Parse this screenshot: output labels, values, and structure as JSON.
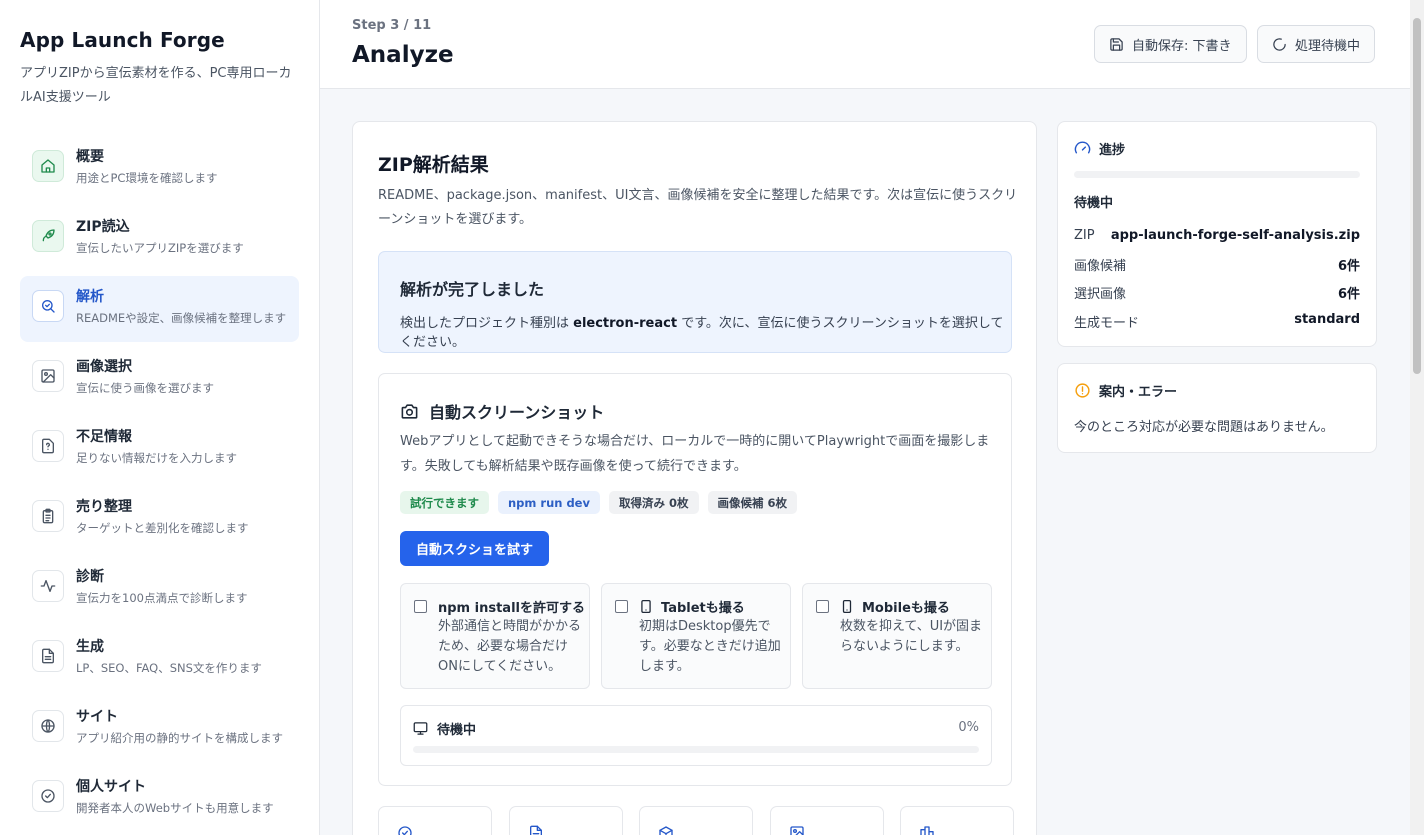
{
  "app": {
    "title": "App Launch Forge",
    "subtitle": "アプリZIPから宣伝素材を作る、PC専用ローカルAI支援ツール"
  },
  "nav": [
    {
      "label": "概要",
      "desc": "用途とPC環境を確認します",
      "icon": "home-icon"
    },
    {
      "label": "ZIP読込",
      "desc": "宣伝したいアプリZIPを選びます",
      "icon": "rocket-icon"
    },
    {
      "label": "解析",
      "desc": "READMEや設定、画像候補を整理します",
      "icon": "search-icon"
    },
    {
      "label": "画像選択",
      "desc": "宣伝に使う画像を選びます",
      "icon": "image-icon"
    },
    {
      "label": "不足情報",
      "desc": "足りない情報だけを入力します",
      "icon": "question-icon"
    },
    {
      "label": "売り整理",
      "desc": "ターゲットと差別化を確認します",
      "icon": "clipboard-icon"
    },
    {
      "label": "診断",
      "desc": "宣伝力を100点満点で診断します",
      "icon": "activity-icon"
    },
    {
      "label": "生成",
      "desc": "LP、SEO、FAQ、SNS文を作ります",
      "icon": "document-icon"
    },
    {
      "label": "サイト",
      "desc": "アプリ紹介用の静的サイトを構成します",
      "icon": "globe-icon"
    },
    {
      "label": "個人サイト",
      "desc": "開発者本人のWebサイトも用意します",
      "icon": "check-circle-icon"
    }
  ],
  "header": {
    "step": "Step 3 / 11",
    "title": "Analyze",
    "autosave_label": "自動保存: 下書き",
    "processing_label": "処理待機中"
  },
  "zip": {
    "title": "ZIP解析結果",
    "desc": "README、package.json、manifest、UI文言、画像候補を安全に整理した結果です。次は宣伝に使うスクリーンショットを選びます。",
    "done_title": "解析が完了しました",
    "done_prefix": "検出したプロジェクト種別は ",
    "done_type": "electron-react",
    "done_suffix": " です。次に、宣伝に使うスクリーンショットを選択してください。"
  },
  "shot": {
    "title": "自動スクリーンショット",
    "desc": "Webアプリとして起動できそうな場合だけ、ローカルで一時的に開いてPlaywrightで画面を撮影します。失敗しても解析結果や既存画像を使って続行できます。",
    "chips": [
      "試行できます",
      "npm run dev",
      "取得済み 0枚",
      "画像候補 6枚"
    ],
    "button": "自動スクショを試す",
    "options": [
      {
        "title": "npm installを許可する",
        "desc": "外部通信と時間がかかるため、必要な場合だけONにしてください。"
      },
      {
        "title": "Tabletも撮る",
        "desc": "初期はDesktop優先です。必要なときだけ追加します。"
      },
      {
        "title": "Mobileも撮る",
        "desc": "枚数を抑えて、UIが固まらないようにします。"
      }
    ],
    "progress_label": "待機中",
    "progress_pct": "0%"
  },
  "progress_card": {
    "title": "進捗",
    "status": "待機中",
    "rows": [
      {
        "k": "ZIP",
        "v": "app-launch-forge-self-analysis.zip"
      },
      {
        "k": "画像候補",
        "v": "6件"
      },
      {
        "k": "選択画像",
        "v": "6件"
      },
      {
        "k": "生成モード",
        "v": "standard"
      }
    ]
  },
  "notice_card": {
    "title": "案内・エラー",
    "text": "今のところ対応が必要な問題はありません。"
  },
  "colors": {
    "accent": "#2563eb",
    "active_nav_bg": "#eef4fe",
    "success": "#1f8a4c",
    "warning": "#f59e0b"
  }
}
